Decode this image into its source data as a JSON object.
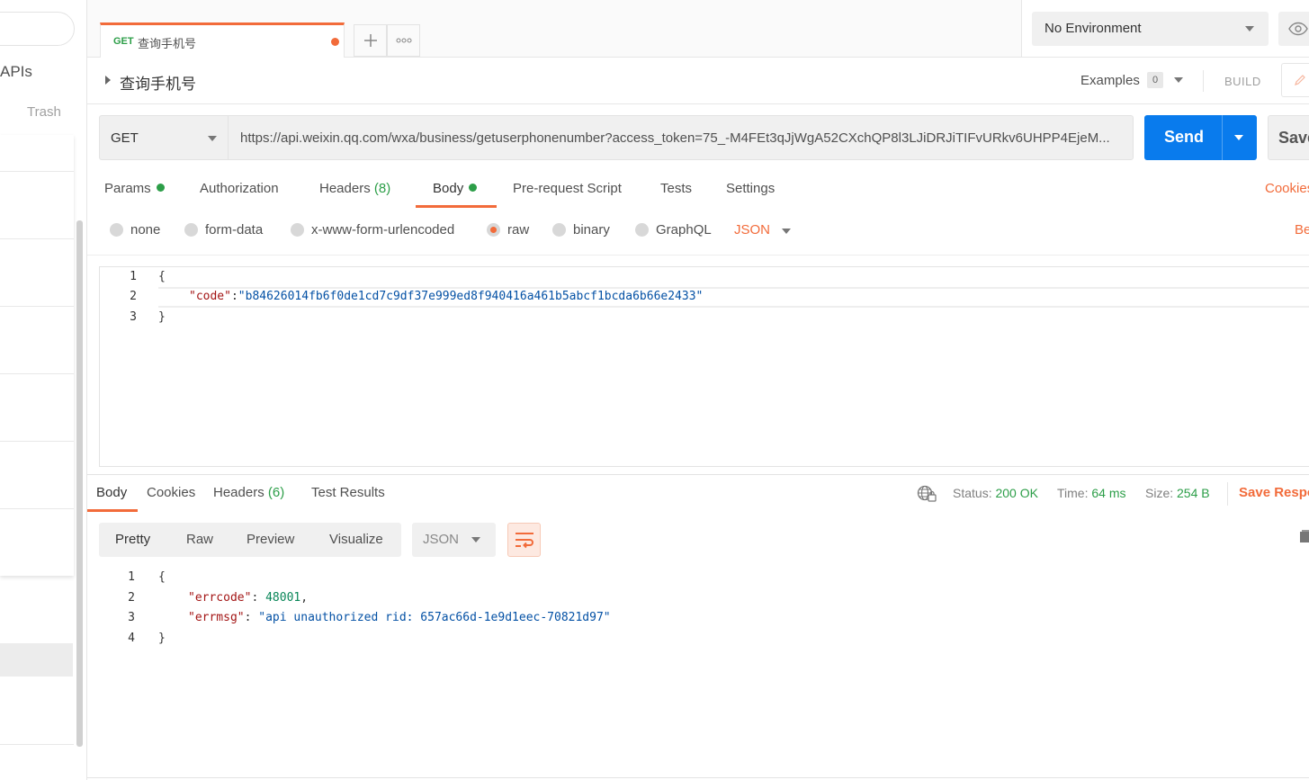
{
  "sidebar": {
    "apis_label": "APIs",
    "trash_label": "Trash"
  },
  "tab": {
    "method": "GET",
    "name": "查询手机号"
  },
  "environment": {
    "selected": "No Environment"
  },
  "title": {
    "name": "查询手机号",
    "examples_label": "Examples",
    "examples_count": "0",
    "build_label": "BUILD"
  },
  "request": {
    "method": "GET",
    "url": "https://api.weixin.qq.com/wxa/business/getuserphonenumber?access_token=75_-M4FEt3qJjWgA52CXchQP8l3LJiDRJiTIFvURkv6UHPP4EjeM...",
    "send_label": "Send",
    "save_label": "Save"
  },
  "request_tabs": {
    "params": "Params",
    "authorization": "Authorization",
    "headers": "Headers",
    "headers_count": "(8)",
    "body": "Body",
    "prerequest": "Pre-request Script",
    "tests": "Tests",
    "settings": "Settings",
    "cookies": "Cookies"
  },
  "body_modes": {
    "none": "none",
    "form_data": "form-data",
    "urlencoded": "x-www-form-urlencoded",
    "raw": "raw",
    "binary": "binary",
    "graphql": "GraphQL",
    "language": "JSON",
    "beautify": "Beautify"
  },
  "request_body": {
    "line_numbers": [
      "1",
      "2",
      "3"
    ],
    "open_brace": "{",
    "key": "\"code\"",
    "colon": ":",
    "value": "\"b84626014fb6f0de1cd7c9df37e999ed8f940416a461b5abcf1bcda6b66e2433\"",
    "close_brace": "}"
  },
  "response_tabs": {
    "body": "Body",
    "cookies": "Cookies",
    "headers": "Headers",
    "headers_count": "(6)",
    "test_results": "Test Results"
  },
  "response_status": {
    "status_label": "Status:",
    "status_value": "200 OK",
    "time_label": "Time:",
    "time_value": "64 ms",
    "size_label": "Size:",
    "size_value": "254 B",
    "save_response": "Save Response"
  },
  "response_toolbar": {
    "pretty": "Pretty",
    "raw": "Raw",
    "preview": "Preview",
    "visualize": "Visualize",
    "format": "JSON"
  },
  "response_body": {
    "line_numbers": [
      "1",
      "2",
      "3",
      "4"
    ],
    "open_brace": "{",
    "errcode_key": "\"errcode\"",
    "errcode_value": "48001",
    "errmsg_key": "\"errmsg\"",
    "errmsg_value": "\"api unauthorized rid: 657ac66d-1e9d1eec-70821d97\"",
    "close_brace": "}"
  },
  "colors": {
    "accent": "#f26b3a",
    "send": "#097bed",
    "success": "#2c9e48"
  }
}
